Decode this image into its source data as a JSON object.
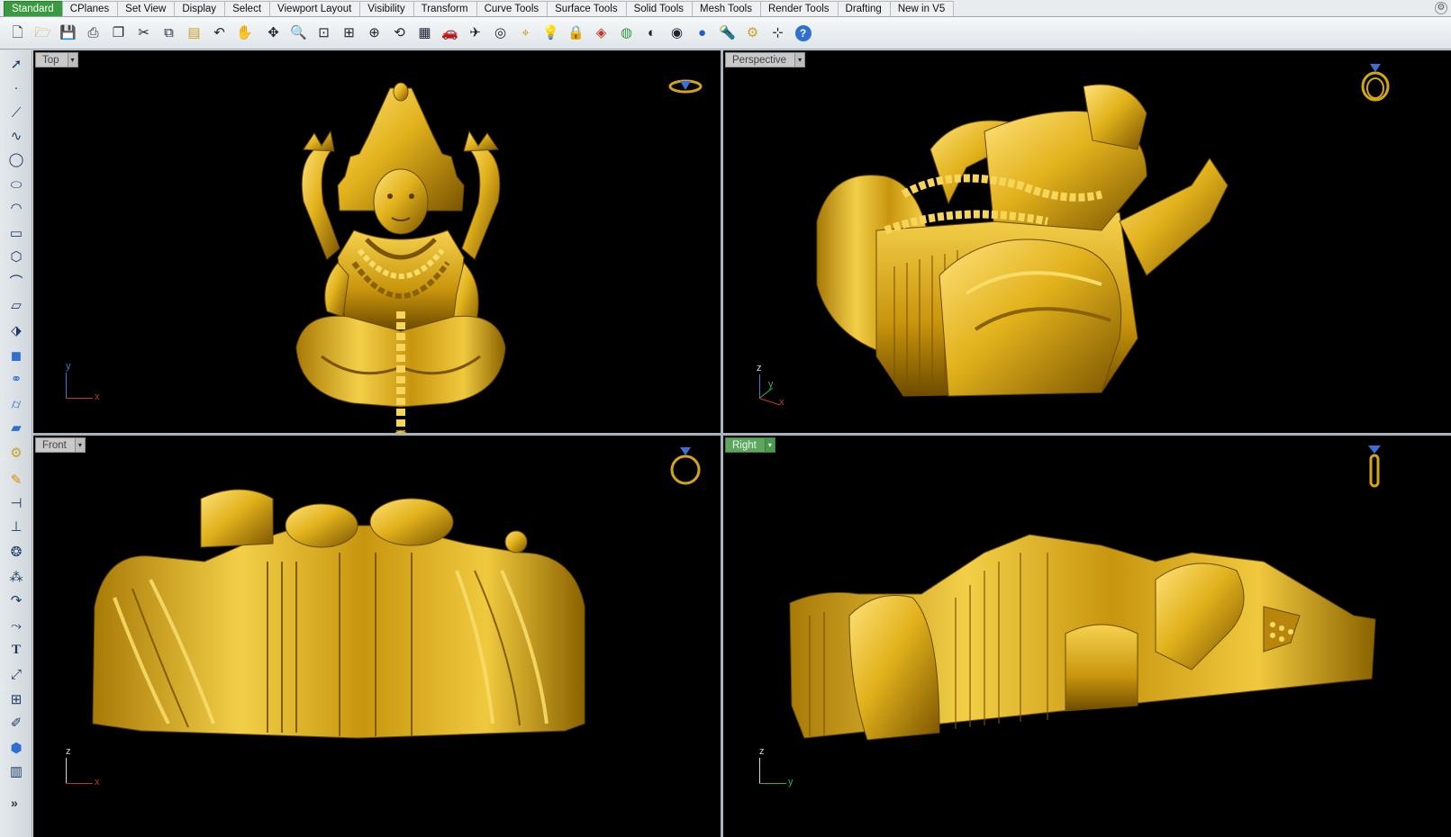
{
  "tabs": [
    "Standard",
    "CPlanes",
    "Set View",
    "Display",
    "Select",
    "Viewport Layout",
    "Visibility",
    "Transform",
    "Curve Tools",
    "Surface Tools",
    "Solid Tools",
    "Mesh Tools",
    "Render Tools",
    "Drafting",
    "New in V5"
  ],
  "toolbar_icons": [
    "new-file-icon",
    "open-folder-icon",
    "save-icon",
    "print-icon",
    "import-icon",
    "cut-icon",
    "copy-icon",
    "paste-icon",
    "undo-icon",
    "pan-hand-icon",
    "move-icon",
    "zoom-icon",
    "zoom-window-icon",
    "zoom-extents-icon",
    "zoom-selected-icon",
    "rotate-view-icon",
    "four-viewports-icon",
    "car-icon",
    "plane-icon",
    "target-icon",
    "snap-icon",
    "light-bulb-icon",
    "lock-icon",
    "layer-icon",
    "color-wheel-icon",
    "shaded-sphere-icon",
    "rendered-sphere-icon",
    "render-sphere-icon",
    "flashlight-icon",
    "gear-icon",
    "grid-snap-icon",
    "help-icon"
  ],
  "sidebar_icons": [
    "select-arrow-icon",
    "point-icon",
    "polyline-icon",
    "curve-icon",
    "circle-icon",
    "ellipse-icon",
    "arc-icon",
    "rectangle-icon",
    "polygon-icon",
    "fillet-curve-icon",
    "surface-icon",
    "extrude-icon",
    "box-icon",
    "boolean-icon",
    "cylinder-icon",
    "mesh-icon",
    "transform-gear-icon",
    "trim-icon",
    "split-icon",
    "dimension-icon",
    "group-icon",
    "join-icon",
    "explode-icon",
    "blend-icon",
    "text-icon",
    "scale-icon",
    "array-icon",
    "edit-icon",
    "render-box-icon",
    "grid-icon"
  ],
  "sidebar_more": "»",
  "tabbar_settings_icon": "settings-gear-icon",
  "viewports": {
    "top": {
      "label": "Top",
      "axis_h": "x",
      "axis_v": "y",
      "icon": "ring-top-icon",
      "active": false
    },
    "perspective": {
      "label": "Perspective",
      "axis_h": "x",
      "axis_v": "z",
      "axis_d": "y",
      "icon": "ring-perspective-icon",
      "active": false
    },
    "front": {
      "label": "Front",
      "axis_h": "x",
      "axis_v": "z",
      "icon": "ring-front-icon",
      "active": false
    },
    "right": {
      "label": "Right",
      "axis_h": "y",
      "axis_v": "z",
      "icon": "ring-right-icon",
      "active": true
    }
  },
  "colors": {
    "accent": "#3a9a3f",
    "model_gold": "#d4a514",
    "model_dark": "#6b4c00",
    "viewport_bg": "#000000"
  }
}
